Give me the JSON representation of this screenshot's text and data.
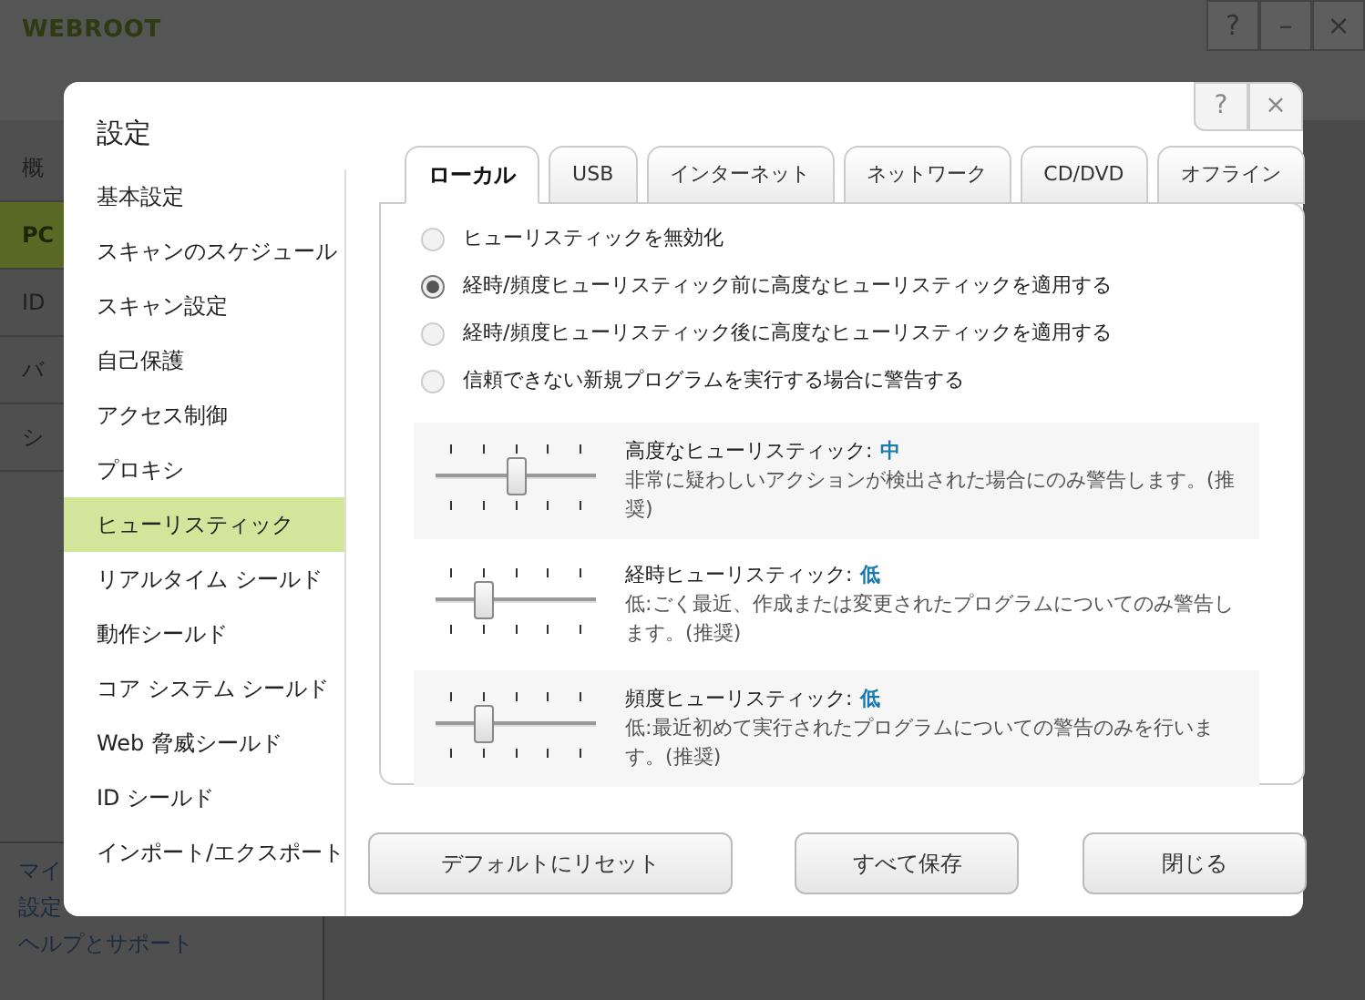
{
  "app": {
    "brand": "WEBROOT",
    "window_buttons": [
      "?",
      "–",
      "×"
    ],
    "nav": [
      {
        "label": "概",
        "selected": false
      },
      {
        "label": "PC",
        "selected": true
      },
      {
        "label": "ID",
        "selected": false
      },
      {
        "label": "バ",
        "selected": false
      },
      {
        "label": "シ",
        "selected": false
      }
    ],
    "footer_links": [
      "マイ",
      "設定",
      "ヘルプとサポート"
    ]
  },
  "dialog": {
    "title": "設定",
    "header_buttons": [
      "?",
      "×"
    ],
    "sidebar": [
      {
        "label": "基本設定",
        "selected": false
      },
      {
        "label": "スキャンのスケジュール",
        "selected": false
      },
      {
        "label": "スキャン設定",
        "selected": false
      },
      {
        "label": "自己保護",
        "selected": false
      },
      {
        "label": "アクセス制御",
        "selected": false
      },
      {
        "label": "プロキシ",
        "selected": false
      },
      {
        "label": "ヒューリスティック",
        "selected": true
      },
      {
        "label": "リアルタイム シールド",
        "selected": false
      },
      {
        "label": "動作シールド",
        "selected": false
      },
      {
        "label": "コア システム シールド",
        "selected": false
      },
      {
        "label": "Web 脅威シールド",
        "selected": false
      },
      {
        "label": "ID シールド",
        "selected": false
      },
      {
        "label": "インポート/エクスポート",
        "selected": false
      }
    ],
    "tabs": [
      {
        "label": "ローカル",
        "selected": true
      },
      {
        "label": "USB",
        "selected": false
      },
      {
        "label": "インターネット",
        "selected": false
      },
      {
        "label": "ネットワーク",
        "selected": false
      },
      {
        "label": "CD/DVD",
        "selected": false
      },
      {
        "label": "オフライン",
        "selected": false
      }
    ],
    "options": [
      {
        "label": "ヒューリスティックを無効化",
        "selected": false
      },
      {
        "label": "経時/頻度ヒューリスティック前に高度なヒューリスティックを適用する",
        "selected": true
      },
      {
        "label": "経時/頻度ヒューリスティック後に高度なヒューリスティックを適用する",
        "selected": false
      },
      {
        "label": "信頼できない新規プログラムを実行する場合に警告する",
        "selected": false
      }
    ],
    "sliders": [
      {
        "title": "高度なヒューリスティック:",
        "value": "中",
        "description": "非常に疑わしいアクションが検出された場合にのみ警告します。(推奨)",
        "level": 0.5
      },
      {
        "title": "経時ヒューリスティック:",
        "value": "低",
        "description": "低:ごく最近、作成または変更されたプログラムについてのみ警告します。(推奨)",
        "level": 0.25
      },
      {
        "title": "頻度ヒューリスティック:",
        "value": "低",
        "description": "低:最近初めて実行されたプログラムについての警告のみを行います。(推奨)",
        "level": 0.25
      }
    ],
    "buttons": [
      "デフォルトにリセット",
      "すべて保存",
      "閉じる"
    ]
  }
}
